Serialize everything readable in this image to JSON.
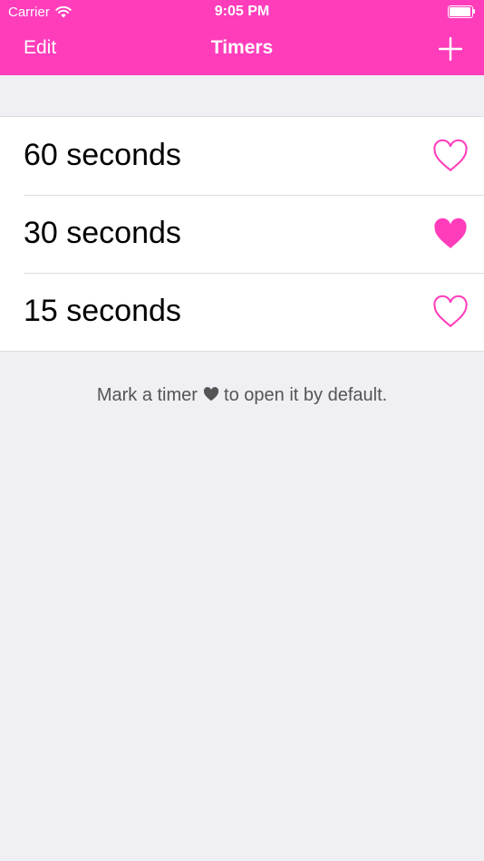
{
  "theme": {
    "accent": "#ff3dbb",
    "background": "#efeff4",
    "hint_text": "#555555"
  },
  "status_bar": {
    "carrier": "Carrier",
    "time": "9:05 PM",
    "battery_icon": "battery-full-icon",
    "wifi_icon": "wifi-icon"
  },
  "nav": {
    "edit_label": "Edit",
    "title": "Timers",
    "add_icon": "plus-icon"
  },
  "timers": [
    {
      "label": "60 seconds",
      "favorite": false
    },
    {
      "label": "30 seconds",
      "favorite": true
    },
    {
      "label": "15 seconds",
      "favorite": false
    }
  ],
  "hint": {
    "before": "Mark a timer ",
    "after": " to open it by default.",
    "icon": "heart-icon"
  }
}
